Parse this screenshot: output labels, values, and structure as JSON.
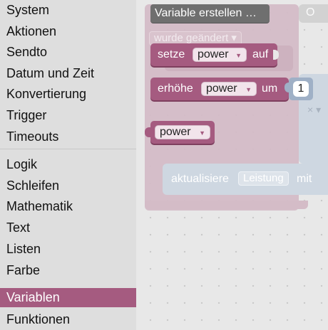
{
  "toolbox": {
    "categories": [
      {
        "label": "System"
      },
      {
        "label": "Aktionen"
      },
      {
        "label": "Sendto"
      },
      {
        "label": "Datum und Zeit"
      },
      {
        "label": "Konvertierung"
      },
      {
        "label": "Trigger"
      },
      {
        "label": "Timeouts"
      },
      {
        "label": "Logik"
      },
      {
        "label": "Schleifen"
      },
      {
        "label": "Mathematik"
      },
      {
        "label": "Text"
      },
      {
        "label": "Listen"
      },
      {
        "label": "Farbe"
      },
      {
        "label": "Variablen"
      },
      {
        "label": "Funktionen"
      }
    ],
    "selected": "Variablen",
    "selected_color": "#a55b80"
  },
  "flyout": {
    "create_button": "Variable erstellen …",
    "set_block": {
      "label": "setze",
      "var": "power",
      "suffix": "auf"
    },
    "change_block": {
      "label": "erhöhe",
      "var": "power",
      "mid": "um",
      "value": "1"
    },
    "get_block": {
      "var": "power"
    },
    "block_color": "#a55b80"
  },
  "background_blocks": {
    "trigger_text": "wurde geändert",
    "update_text": "aktualisiere",
    "update_var": "Leistung",
    "update_suffix": "mit",
    "corner_text": "O"
  }
}
